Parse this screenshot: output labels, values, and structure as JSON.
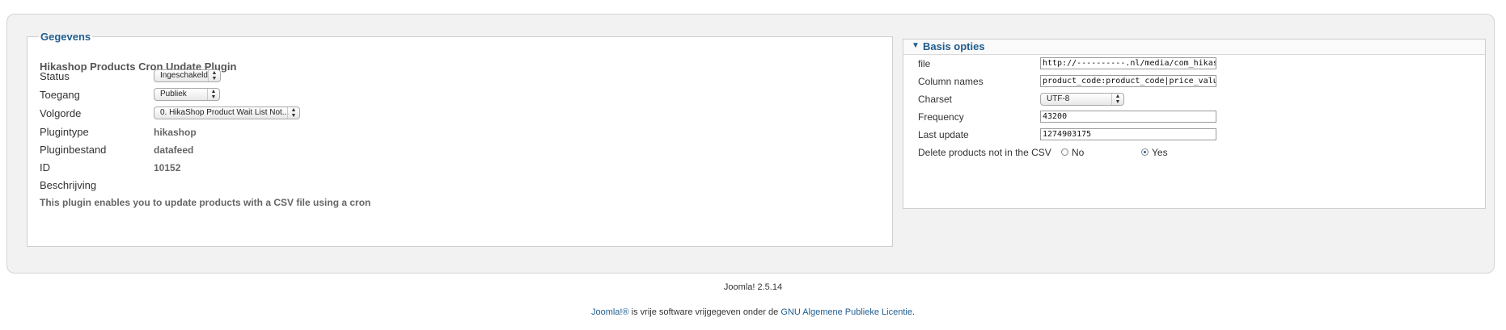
{
  "gegevens": {
    "legend": "Gegevens",
    "plugin_title": "Hikashop Products Cron Update Plugin",
    "status_label": "Status",
    "status_value": "Ingeschakeld",
    "toegang_label": "Toegang",
    "toegang_value": "Publiek",
    "volgorde_label": "Volgorde",
    "volgorde_value": "0. HikaShop Product Wait List Not...",
    "plugintype_label": "Plugintype",
    "plugintype_value": "hikashop",
    "pluginbestand_label": "Pluginbestand",
    "pluginbestand_value": "datafeed",
    "id_label": "ID",
    "id_value": "10152",
    "beschrijving_label": "Beschrijving",
    "description": "This plugin enables you to update products with a CSV file using a cron"
  },
  "basis": {
    "title": "Basis opties",
    "file_label": "file",
    "file_value": "http://----------.nl/media/com_hikashop/u",
    "columns_label": "Column names",
    "columns_value": "product_code:product_code|price_value:pric",
    "charset_label": "Charset",
    "charset_value": "UTF-8",
    "frequency_label": "Frequency",
    "frequency_value": "43200",
    "lastupdate_label": "Last update",
    "lastupdate_value": "1274903175",
    "delete_label": "Delete products not in the CSV",
    "no_label": "No",
    "yes_label": "Yes",
    "delete_selected": "Yes"
  },
  "footer": {
    "version": "Joomla! 2.5.14",
    "joomla_link": "Joomla!®",
    "middle_text": " is vrije software vrijgegeven onder de ",
    "license_link": "GNU Algemene Publieke Licentie",
    "end": "."
  },
  "colors": {
    "accent": "#1f5c8e",
    "panel_bg": "#f2f2f2"
  }
}
